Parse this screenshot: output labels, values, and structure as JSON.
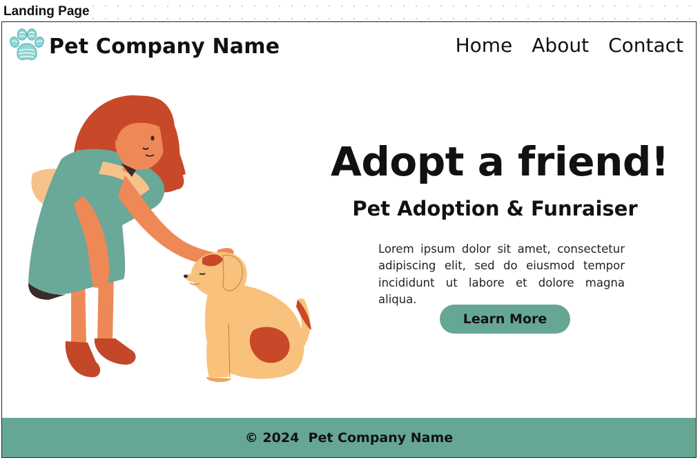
{
  "frame": {
    "label": "Landing Page"
  },
  "header": {
    "brand": "Pet Company Name",
    "nav": [
      "Home",
      "About",
      "Contact"
    ],
    "logo_icon": "paw-print-icon"
  },
  "hero": {
    "title": "Adopt a friend!",
    "subtitle": "Pet Adoption & Funraiser",
    "body": "Lorem ipsum dolor sit amet, consectetur adipiscing elit, sed do eiusmod tempor incididunt ut labore et dolore magna aliqua.",
    "cta_label": "Learn More",
    "illustration": "girl-petting-dog-illustration"
  },
  "footer": {
    "text": "© 2024  Pet Company Name"
  },
  "colors": {
    "accent": "#66a695",
    "paw": "#7fd0cf",
    "hair": "#c8482a",
    "dress": "#6aa899",
    "dog": "#f8c27c"
  }
}
